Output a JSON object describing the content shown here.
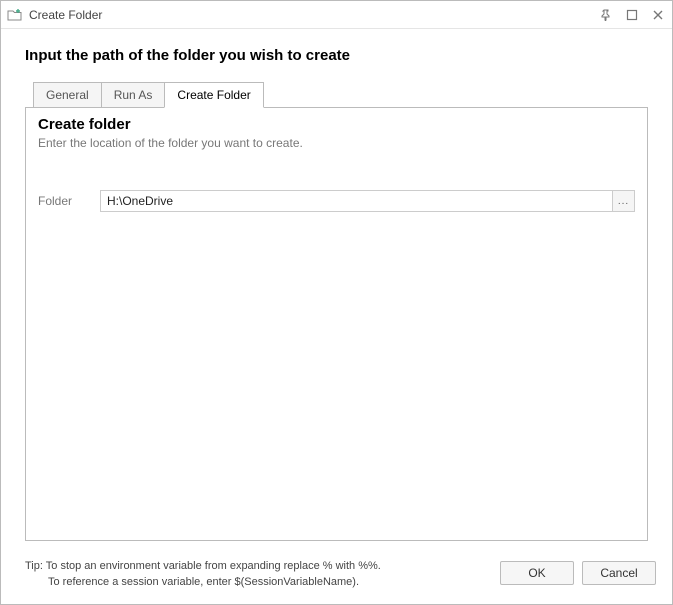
{
  "window": {
    "title": "Create Folder"
  },
  "heading": "Input the path of the folder you wish to create",
  "tabs": {
    "general": "General",
    "run_as": "Run As",
    "create_folder": "Create Folder"
  },
  "panel": {
    "heading": "Create folder",
    "sub": "Enter the location of the folder you want to create."
  },
  "form": {
    "folder_label": "Folder",
    "folder_value": "H:\\OneDrive",
    "browse_label": "..."
  },
  "tip": {
    "line1": "Tip: To stop an environment variable from expanding replace % with %%.",
    "line2": "To reference a session variable, enter $(SessionVariableName)."
  },
  "buttons": {
    "ok": "OK",
    "cancel": "Cancel"
  }
}
